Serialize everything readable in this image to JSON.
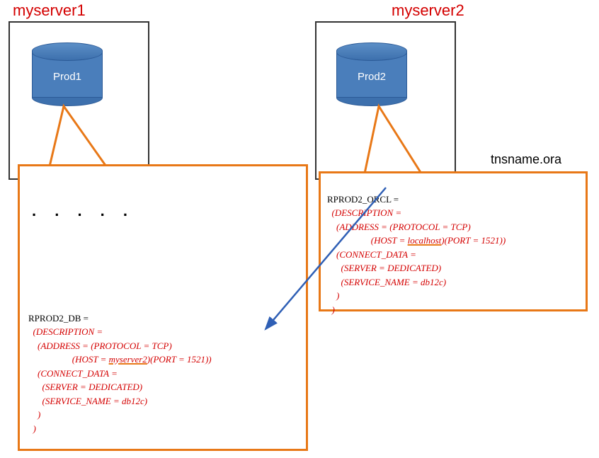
{
  "servers": {
    "left": {
      "label": "myserver1",
      "db_label": "Prod1"
    },
    "right": {
      "label": "myserver2",
      "db_label": "Prod2"
    }
  },
  "file_label": "tnsname.ora",
  "dots": ".  .  .  .  .",
  "tns_left": {
    "alias": "RPROD2_DB =",
    "desc_open": "(DESCRIPTION =",
    "addr_line1": "(ADDRESS = (PROTOCOL = TCP)",
    "addr_host_pre": "(HOST = ",
    "addr_host": "myserver2",
    "addr_host_post": ")(PORT = 1521))",
    "conn_open": "(CONNECT_DATA =",
    "server_line": "(SERVER = DEDICATED)",
    "service_line": "(SERVICE_NAME = db12c)",
    "close1": ")",
    "close2": ")"
  },
  "tns_right": {
    "alias": "RPROD2_ORCL =",
    "desc_open": "(DESCRIPTION =",
    "addr_line1": "(ADDRESS = (PROTOCOL = TCP)",
    "addr_host_pre": "(HOST = ",
    "addr_host": "localhost",
    "addr_host_post": ")(PORT = 1521))",
    "conn_open": "(CONNECT_DATA =",
    "server_line": "(SERVER = DEDICATED)",
    "service_line": "(SERVICE_NAME = db12c)",
    "close1": ")",
    "close2": ")"
  },
  "colors": {
    "accent_orange": "#e87817",
    "accent_red": "#d40000",
    "arrow_blue": "#2f5fb5",
    "db_fill": "#4a7ebb"
  }
}
